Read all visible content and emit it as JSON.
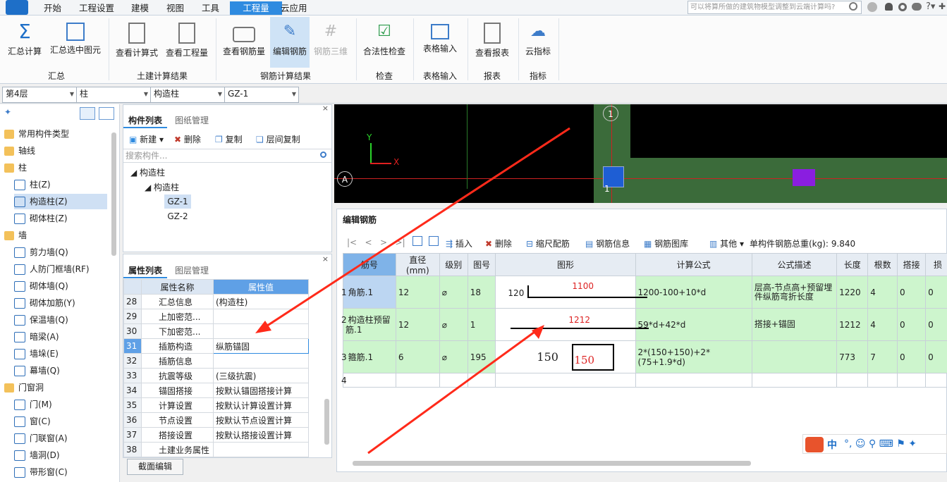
{
  "menu": {
    "tabs": [
      "开始",
      "工程设置",
      "建模",
      "视图",
      "工具",
      "工程量",
      "云应用"
    ],
    "active_tab": "工程量",
    "search_text": "可以将算所做的建筑物模型调整到云端计算吗?"
  },
  "ribbon": {
    "buttons": [
      "汇总计算",
      "汇总选中图元",
      "查看计算式",
      "查看工程量",
      "查看钢筋量",
      "编辑钢筋",
      "钢筋三维",
      "合法性检查",
      "表格输入",
      "查看报表",
      "云指标"
    ],
    "groups": [
      "汇总",
      "土建计算结果",
      "钢筋计算结果",
      "检查",
      "表格输入",
      "报表",
      "指标"
    ]
  },
  "selectors": {
    "floor": "第4层",
    "type": "柱",
    "subtype": "构造柱",
    "component": "GZ-1"
  },
  "left_tree": {
    "items": [
      "常用构件类型",
      "轴线",
      "柱",
      "柱(Z)",
      "构造柱(Z)",
      "砌体柱(Z)",
      "墙",
      "剪力墙(Q)",
      "人防门框墙(RF)",
      "砌体墙(Q)",
      "砌体加筋(Y)",
      "保温墙(Q)",
      "暗梁(A)",
      "墙垛(E)",
      "幕墙(Q)",
      "门窗洞",
      "门(M)",
      "窗(C)",
      "门联窗(A)",
      "墙洞(D)",
      "带形窗(C)"
    ]
  },
  "component_panel": {
    "tabs": [
      "构件列表",
      "图纸管理"
    ],
    "toolbar": [
      "新建",
      "删除",
      "复制",
      "层间复制"
    ],
    "search_placeholder": "搜索构件...",
    "tree": [
      "构造柱",
      "构造柱",
      "GZ-1",
      "GZ-2"
    ]
  },
  "property_panel": {
    "tabs": [
      "属性列表",
      "图层管理"
    ],
    "headers": [
      "属性名称",
      "属性值"
    ],
    "rows": [
      {
        "no": "28",
        "name": "汇总信息",
        "value": "(构造柱)"
      },
      {
        "no": "29",
        "name": "上加密范...",
        "value": ""
      },
      {
        "no": "30",
        "name": "下加密范...",
        "value": ""
      },
      {
        "no": "31",
        "name": "插筋构造",
        "value": "纵筋锚固"
      },
      {
        "no": "32",
        "name": "插筋信息",
        "value": ""
      },
      {
        "no": "33",
        "name": "抗震等级",
        "value": "(三级抗震)"
      },
      {
        "no": "34",
        "name": "锚固搭接",
        "value": "按默认锚固搭接计算"
      },
      {
        "no": "35",
        "name": "计算设置",
        "value": "按默认计算设置计算"
      },
      {
        "no": "36",
        "name": "节点设置",
        "value": "按默认节点设置计算"
      },
      {
        "no": "37",
        "name": "搭接设置",
        "value": "按默认搭接设置计算"
      },
      {
        "no": "38",
        "name": "土建业务属性",
        "value": ""
      }
    ],
    "footer_button": "截面编辑"
  },
  "drawing": {
    "axis_x": "X",
    "axis_y": "Y",
    "axis_a": "A",
    "axis_1_top": "1",
    "axis_1_bottom": "1"
  },
  "rebar_editor": {
    "title": "编辑钢筋",
    "toolbar": [
      "插入",
      "删除",
      "缩尺配筋",
      "钢筋信息",
      "钢筋图库",
      "其他"
    ],
    "total_label": "单构件钢筋总重(kg):",
    "total_value": "9.840",
    "columns": [
      "筋号",
      "直径(mm)",
      "级别",
      "图号",
      "图形",
      "计算公式",
      "公式描述",
      "长度",
      "根数",
      "搭接",
      "损"
    ],
    "rows": [
      {
        "no": "1",
        "name": "角筋.1",
        "dia": "12",
        "grade": "⌀",
        "fig": "18",
        "shape_left": "120",
        "shape_main": "1100",
        "formula": "1200-100+10*d",
        "desc": "层高-节点高+预留埋件纵筋弯折长度",
        "len": "1220",
        "count": "4",
        "lap": "0",
        "loss": "0"
      },
      {
        "no": "2",
        "name": "构造柱预留筋.1",
        "dia": "12",
        "grade": "⌀",
        "fig": "1",
        "shape_main": "1212",
        "formula": "59*d+42*d",
        "desc": "搭接+锚固",
        "len": "1212",
        "count": "4",
        "lap": "0",
        "loss": "0"
      },
      {
        "no": "3",
        "name": "箍筋.1",
        "dia": "6",
        "grade": "⌀",
        "fig": "195",
        "shape_left": "150",
        "shape_main": "150",
        "formula": "2*(150+150)+2*(75+1.9*d)",
        "desc": "",
        "len": "773",
        "count": "7",
        "lap": "0",
        "loss": "0"
      },
      {
        "no": "4",
        "name": "",
        "dia": "",
        "grade": "",
        "fig": "",
        "formula": "",
        "desc": "",
        "len": "",
        "count": "",
        "lap": "",
        "loss": ""
      }
    ]
  },
  "ime_bar": {
    "lang": "中"
  }
}
